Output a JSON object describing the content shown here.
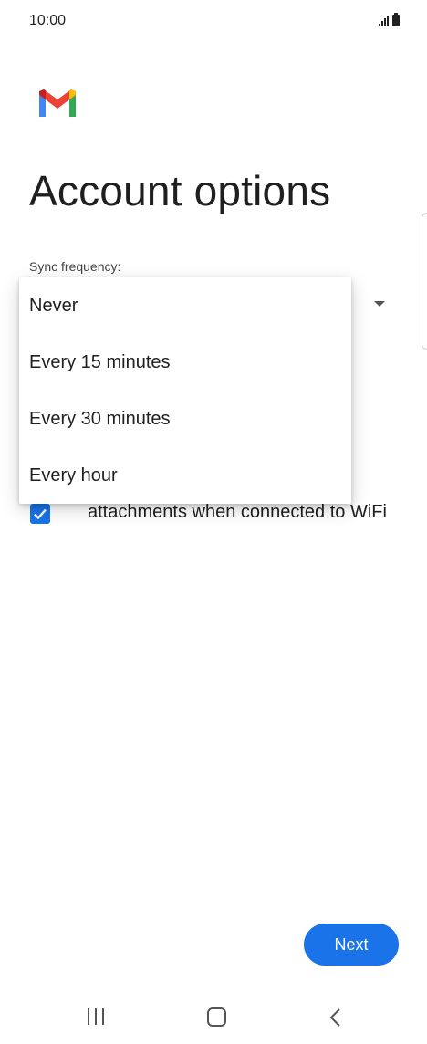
{
  "status_bar": {
    "time": "10:00"
  },
  "page": {
    "title": "Account options"
  },
  "sync": {
    "label": "Sync frequency:"
  },
  "menu": {
    "options": [
      "Never",
      "Every 15 minutes",
      "Every 30 minutes",
      "Every hour"
    ]
  },
  "option": {
    "checked": true,
    "text": "attachments when connected to WiFi"
  },
  "actions": {
    "next_label": "Next"
  },
  "colors": {
    "accent": "#1a73e8"
  },
  "icons": {
    "logo": "gmail-logo",
    "checkbox": "check-icon",
    "dropdown": "caret-down-icon"
  }
}
